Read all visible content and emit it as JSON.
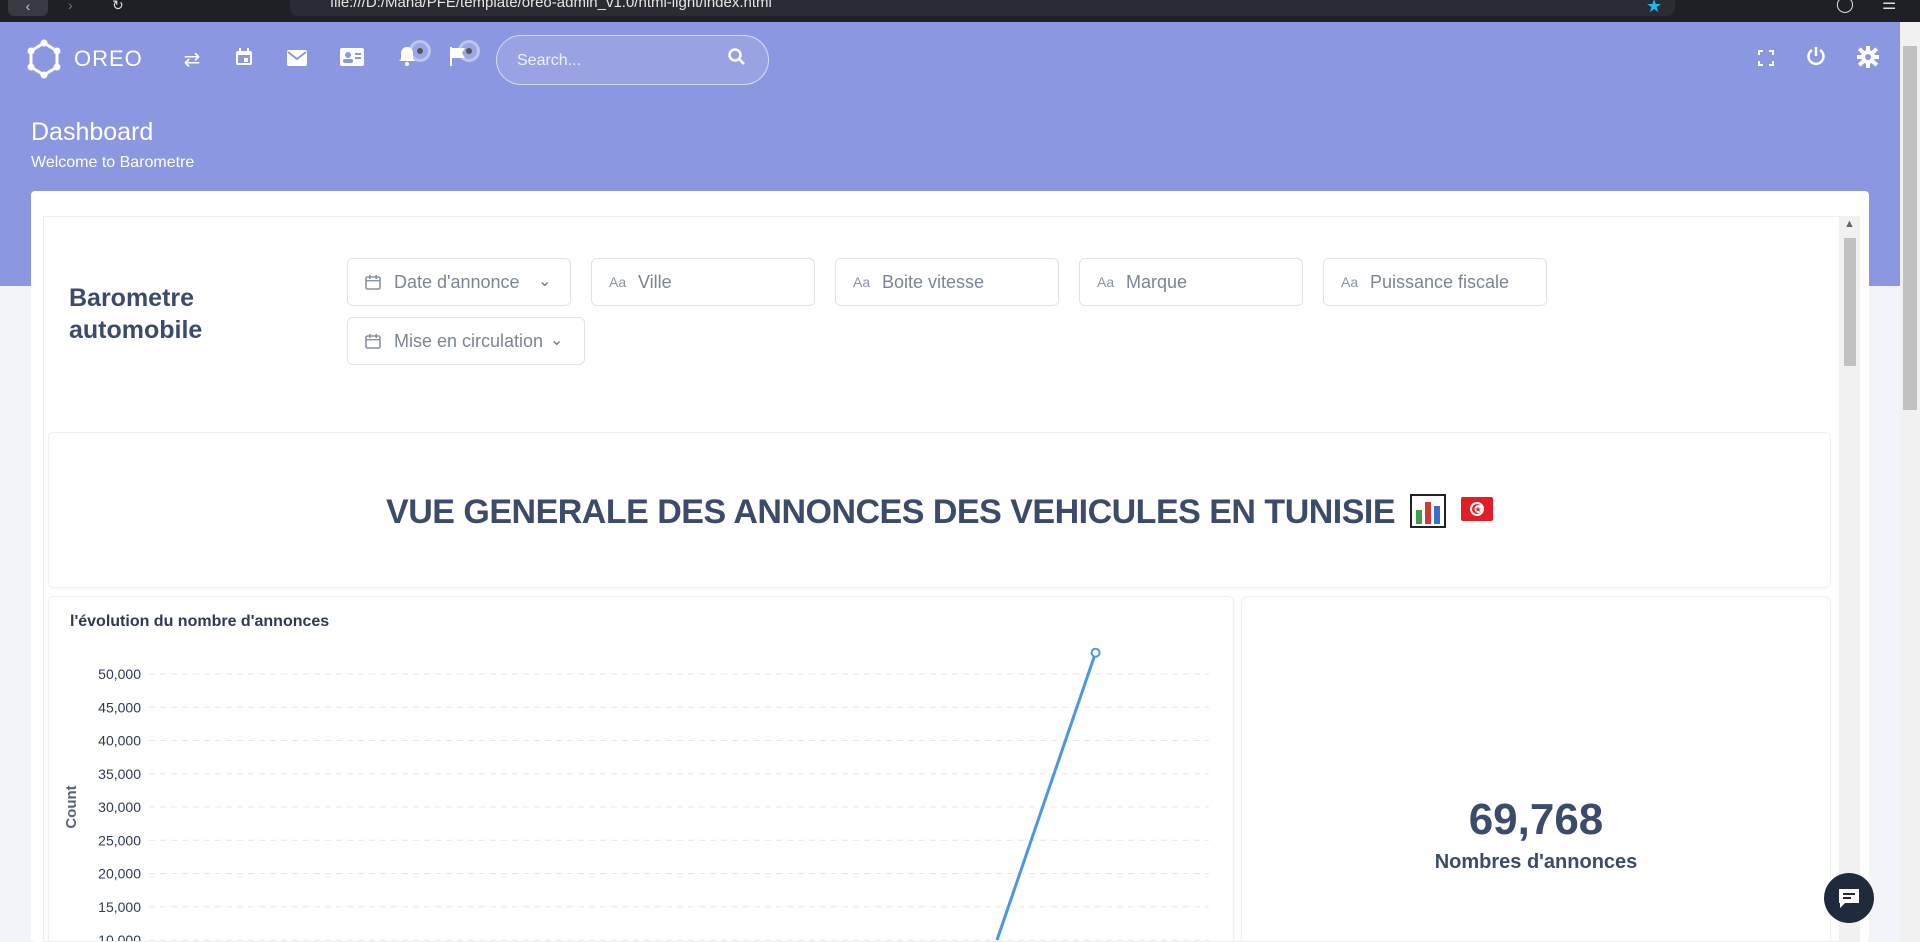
{
  "browser": {
    "url": "file:///D:/Mana/PFE/template/oreo-admin_v1.0/html-light/index.html"
  },
  "navbar": {
    "brand": "OREO",
    "icons": [
      "swap-icon",
      "calendar-icon",
      "mail-icon",
      "contact-card-icon",
      "bell-icon",
      "flag-icon"
    ],
    "search_placeholder": "Search...",
    "right_icons": [
      "fullscreen-icon",
      "power-icon",
      "settings-icon"
    ],
    "accent": "#8b97e0"
  },
  "header": {
    "title": "Dashboard",
    "subtitle": "Welcome to Barometre"
  },
  "dashboard": {
    "title": "Barometre automobile",
    "filters": [
      {
        "label": "Date d'annonce",
        "icon": "calendar-icon",
        "dropdown": true
      },
      {
        "label": "Ville",
        "icon": "text-icon",
        "dropdown": false
      },
      {
        "label": "Boite vitesse",
        "icon": "text-icon",
        "dropdown": false
      },
      {
        "label": "Marque",
        "icon": "text-icon",
        "dropdown": false
      },
      {
        "label": "Puissance fiscale",
        "icon": "text-icon",
        "dropdown": false
      },
      {
        "label": "Mise en circulation",
        "icon": "calendar-icon",
        "dropdown": true
      }
    ],
    "headline": "VUE GENERALE DES ANNONCES DES VEHICULES EN TUNISIE",
    "headline_emojis": [
      "bar-chart-emoji",
      "tunisia-flag-emoji"
    ],
    "kpi": {
      "value": "69,768",
      "label": "Nombres d'annonces"
    }
  },
  "chart_data": {
    "type": "line",
    "title": "l'évolution du nombre d'annonces",
    "xlabel": "",
    "ylabel": "Count",
    "ylim": [
      10000,
      50000
    ],
    "yticks": [
      50000,
      45000,
      40000,
      35000,
      30000,
      25000,
      20000,
      15000,
      10000
    ],
    "ytick_labels": [
      "50,000",
      "45,000",
      "40,000",
      "35,000",
      "30,000",
      "25,000",
      "20,000",
      "15,000",
      "10,000"
    ],
    "grid": true,
    "series": [
      {
        "color": "#4e97df",
        "points": [
          [
            0.8,
            10000
          ],
          [
            0.893,
            53200
          ]
        ]
      }
    ]
  }
}
